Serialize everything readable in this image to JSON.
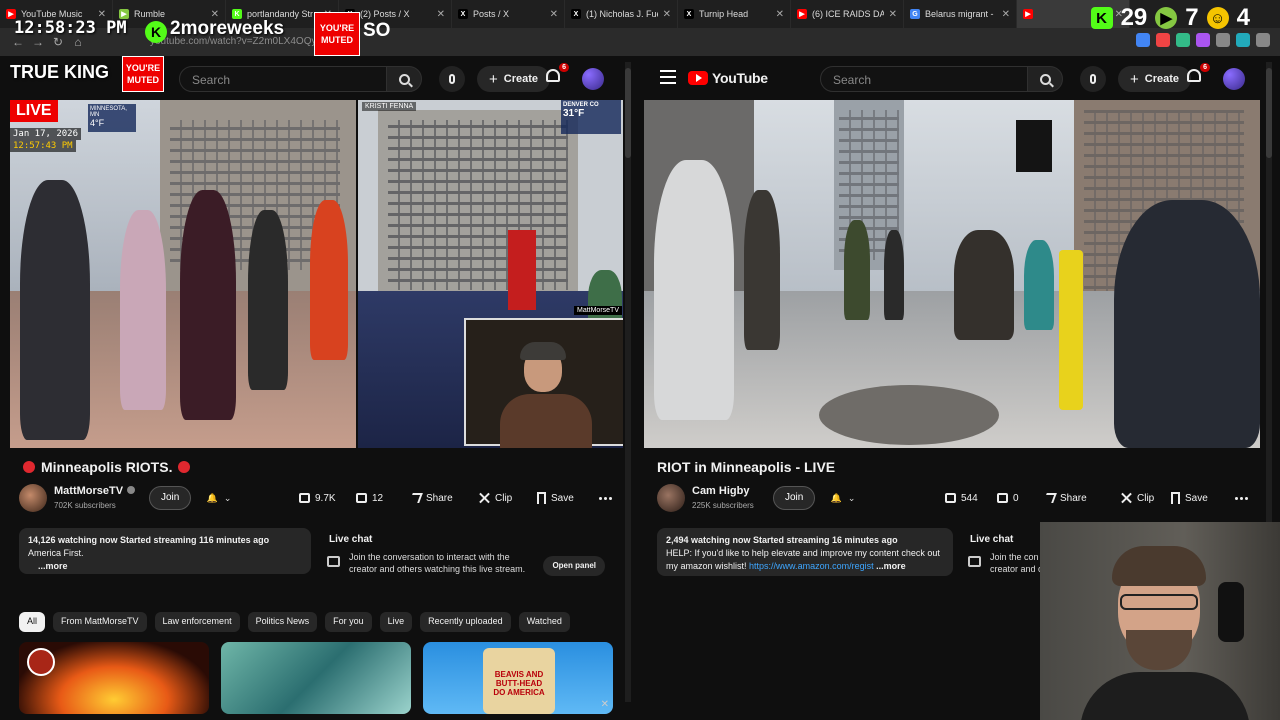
{
  "browser": {
    "tabs": [
      {
        "title": "YouTube Music",
        "fav_color": "#ff0000",
        "fav_glyph": "▶"
      },
      {
        "title": "Rumble",
        "fav_color": "#85c742",
        "fav_glyph": "▶"
      },
      {
        "title": "portlandandy Str",
        "fav_color": "#53fc18",
        "fav_glyph": "K"
      },
      {
        "title": "(2) Posts / X",
        "fav_color": "#000000",
        "fav_glyph": "X"
      },
      {
        "title": "Posts / X",
        "fav_color": "#000000",
        "fav_glyph": "X"
      },
      {
        "title": "(1) Nicholas J. Fue",
        "fav_color": "#000000",
        "fav_glyph": "X"
      },
      {
        "title": "Turnip Head",
        "fav_color": "#000000",
        "fav_glyph": "X"
      },
      {
        "title": "(6) ICE RAIDS DAY",
        "fav_color": "#ff0000",
        "fav_glyph": "▶"
      },
      {
        "title": "Belarus migrant -",
        "fav_color": "#4285f4",
        "fav_glyph": "G"
      },
      {
        "title": "",
        "fav_color": "#ff0000",
        "fav_glyph": "▶"
      }
    ],
    "url": "youtube.com/watch?v=Z2m0LX4OQyKw"
  },
  "overlay": {
    "clock": "12:58:23 PM",
    "kick_glyph": "K",
    "streamer_word": "2moreweeks",
    "muted_label": "YOU'RE MUTED",
    "so_word": "SO",
    "true_king": "TRUE KING",
    "counter_a": "29",
    "counter_b": "7",
    "counter_c": "4"
  },
  "left": {
    "search_placeholder": "Search",
    "create_label": "Create",
    "notif_count": "6",
    "live_label": "LIVE",
    "location": "MINNESOTA, MN",
    "temp_left": "4°F",
    "stream_date": "Jan 17, 2026",
    "stream_time": "12:57:43 PM",
    "reporter_tag": "KRISTI FENNA",
    "weather_city": "DENVER CO",
    "temp_right": "31°F",
    "cam_tag": "MattMorseTV",
    "title": "Minneapolis RIOTS.",
    "channel": "MattMorseTV",
    "subs": "702K subscribers",
    "join": "Join",
    "likes": "9.7K",
    "dislikes": "12",
    "share": "Share",
    "clip": "Clip",
    "save": "Save",
    "desc_stats": "14,126 watching now  Started streaming 116 minutes ago",
    "desc_text": "America First.",
    "desc_more": "...more",
    "chat_title": "Live chat",
    "chat_msg": "Join the conversation to interact with the creator and others watching this live stream.",
    "chat_open": "Open panel",
    "chips": [
      "All",
      "From MattMorseTV",
      "Law enforcement",
      "Politics News",
      "For you",
      "Live",
      "Recently uploaded",
      "Watched"
    ],
    "thumb3_text": "BEAVIS AND BUTT-HEAD DO AMERICA"
  },
  "right": {
    "logo": "YouTube",
    "search_placeholder": "Search",
    "create_label": "Create",
    "notif_count": "6",
    "title": "RIOT in Minneapolis - LIVE",
    "channel": "Cam Higby",
    "subs": "225K subscribers",
    "join": "Join",
    "likes": "544",
    "dislikes": "0",
    "share": "Share",
    "clip": "Clip",
    "save": "Save",
    "desc_stats": "2,494 watching now  Started streaming 16 minutes ago",
    "desc_text": "HELP: If you'd like to help elevate and improve my content check out my amazon wishlist!",
    "desc_link": "https://www.amazon.com/regist",
    "desc_more": "...more",
    "chat_title": "Live chat",
    "chat_msg": "Join the con creator and o"
  }
}
